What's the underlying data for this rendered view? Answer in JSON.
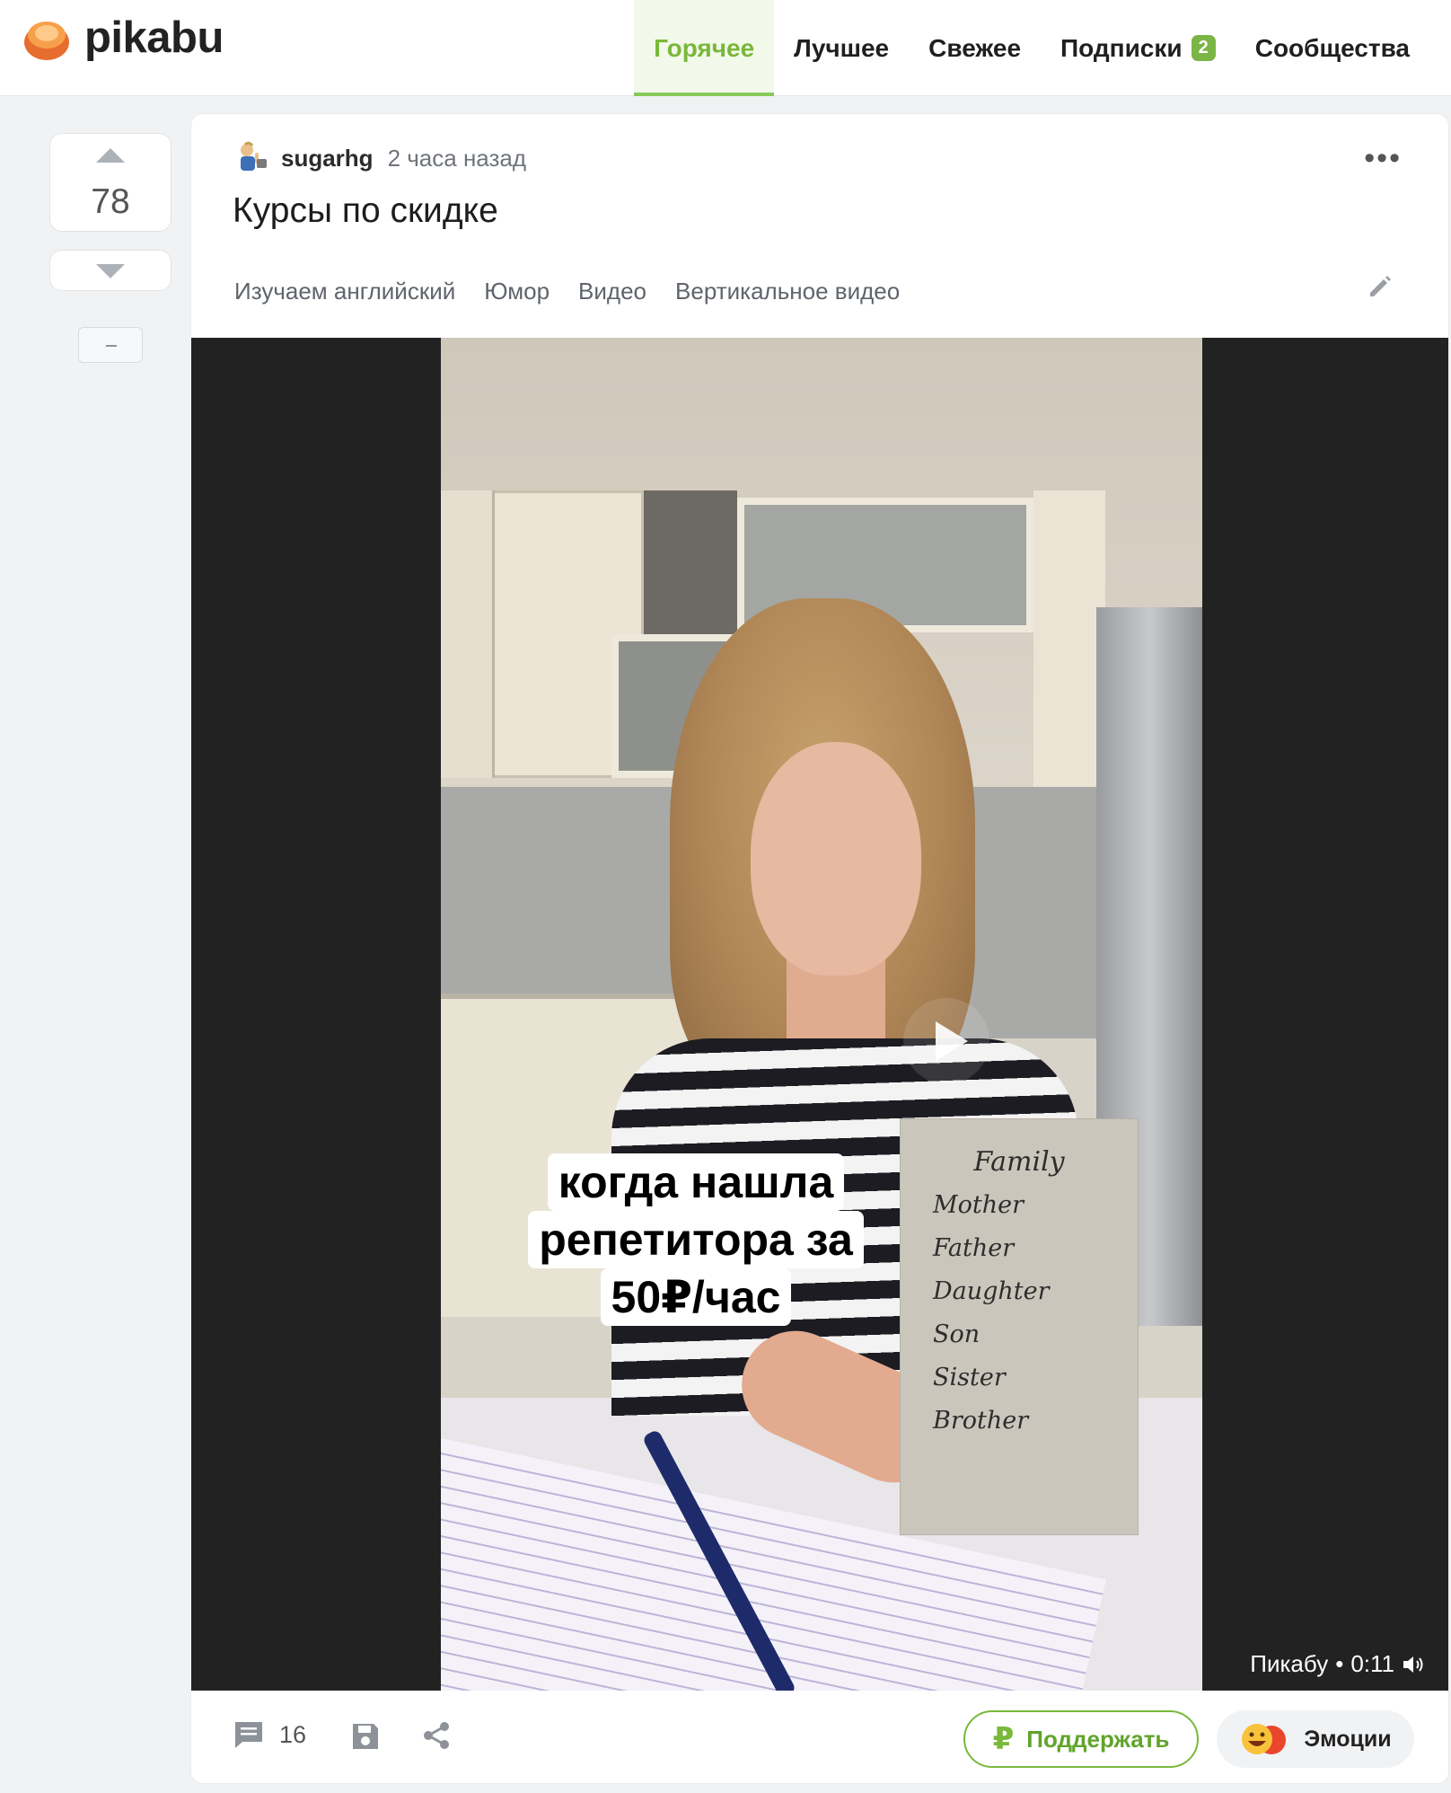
{
  "header": {
    "logo_text": "pikabu",
    "nav": [
      {
        "label": "Горячее",
        "active": true
      },
      {
        "label": "Лучшее"
      },
      {
        "label": "Свежее"
      },
      {
        "label": "Подписки",
        "badge": "2"
      },
      {
        "label": "Сообщества"
      }
    ]
  },
  "vote": {
    "rating": "78",
    "up_icon": "triangle-up-icon",
    "down_icon": "triangle-down-icon",
    "collapse_icon": "minus-icon"
  },
  "story": {
    "author": "sugarhg",
    "time": "2 часа назад",
    "title": "Курсы по скидке",
    "tags": [
      "Изучаем английский",
      "Юмор",
      "Видео",
      "Вертикальное видео"
    ],
    "more_icon": "more-dots-icon",
    "edit_icon": "pencil-icon"
  },
  "video": {
    "caption_lines": [
      "когда нашла",
      "репетитора за",
      "50₽/час"
    ],
    "card_title": "Family",
    "card_items": [
      "Mother",
      "Father",
      "Daughter",
      "Son",
      "Sister",
      "Brother"
    ],
    "source": "Пикабу",
    "separator": "•",
    "duration": "0:11",
    "play_icon": "play-icon",
    "sound_icon": "speaker-icon"
  },
  "footer": {
    "comments_count": "16",
    "comments_icon": "comment-icon",
    "save_icon": "save-icon",
    "share_icon": "share-icon",
    "support_symbol": "₽",
    "support_label": "Поддержать",
    "emotions_label": "Эмоции"
  },
  "colors": {
    "accent": "#79b83a",
    "badge": "#7ab546",
    "background": "#f1f2f4"
  }
}
